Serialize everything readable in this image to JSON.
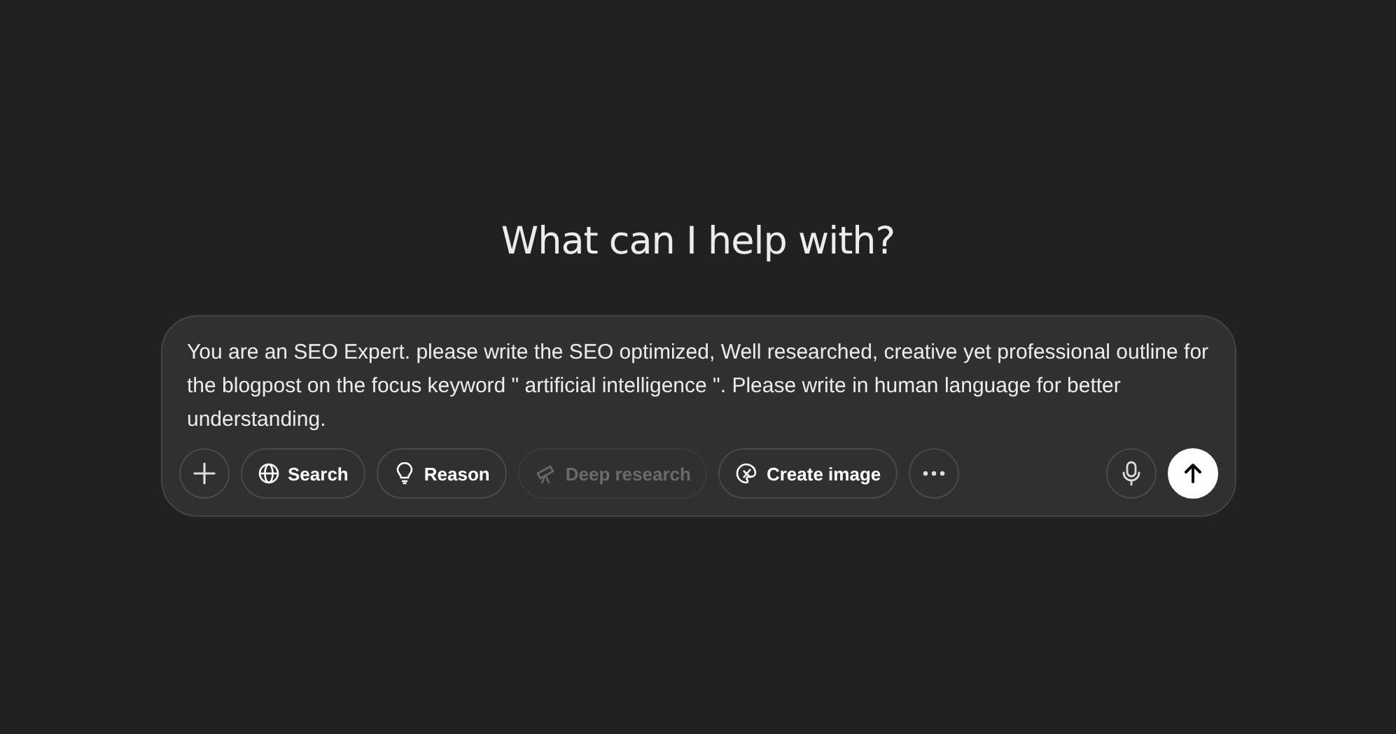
{
  "heading": "What can I help with?",
  "composer": {
    "value": "You are an SEO Expert. please write the SEO optimized, Well researched, creative yet professional outline for the blogpost on the focus keyword \" artificial intelligence \". Please write in human language for better understanding.",
    "tools": [
      {
        "kind": "search",
        "label": "Search",
        "disabled": false
      },
      {
        "kind": "reason",
        "label": "Reason",
        "disabled": false
      },
      {
        "kind": "deep-research",
        "label": "Deep research",
        "disabled": true
      },
      {
        "kind": "create-image",
        "label": "Create image",
        "disabled": false
      }
    ]
  }
}
